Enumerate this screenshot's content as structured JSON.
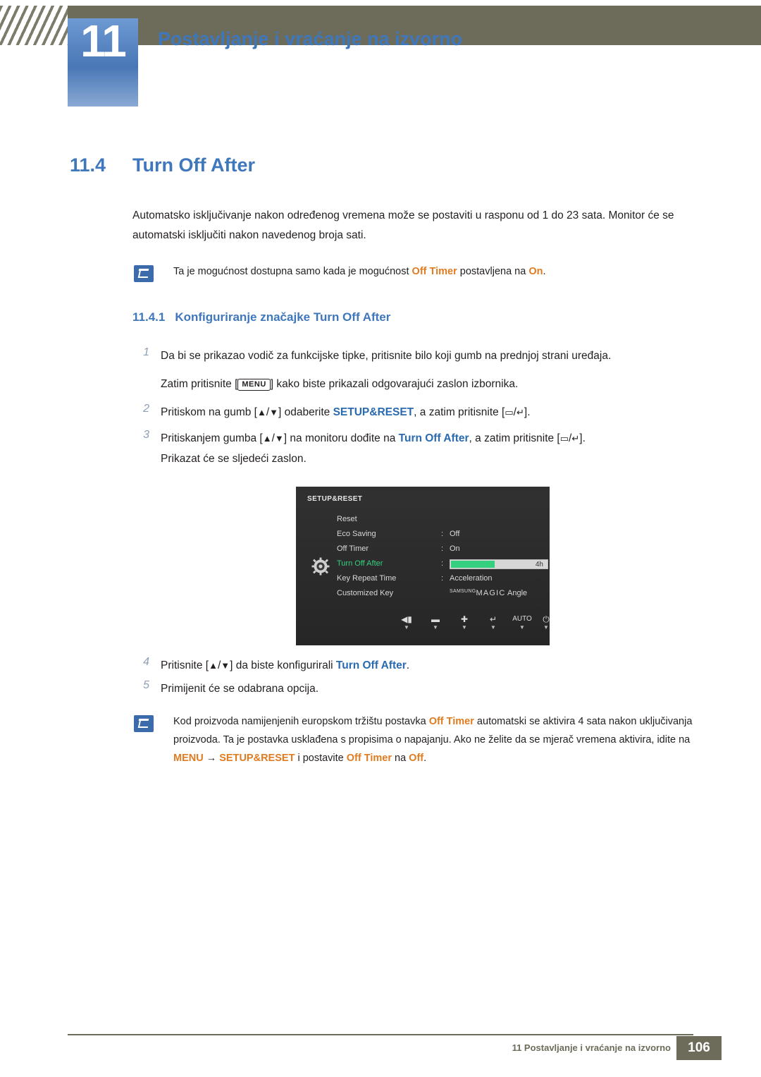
{
  "header": {
    "chapter_number": "11",
    "title": "Postavljanje i vraćanje na izvorno"
  },
  "section": {
    "number": "11.4",
    "title": "Turn Off After"
  },
  "intro": "Automatsko isključivanje nakon određenog vremena može se postaviti u rasponu od 1 do 23 sata. Monitor će se automatski isključiti nakon navedenog broja sati.",
  "note1": {
    "text_before": "Ta je mogućnost dostupna samo kada je mogućnost ",
    "highlight1": "Off Timer",
    "text_mid": " postavljena na ",
    "highlight2": "On",
    "text_after": "."
  },
  "subsection": {
    "number": "11.4.1",
    "title": "Konfiguriranje značajke Turn Off After"
  },
  "steps": {
    "n1": "1",
    "n2": "2",
    "n3": "3",
    "n4": "4",
    "n5": "5",
    "s1a": "Da bi se prikazao vodič za funkcijske tipke, pritisnite bilo koji gumb na prednjoj strani uređaja.",
    "s1b_before": "Zatim pritisnite [",
    "s1b_key": "MENU",
    "s1b_after": "] kako biste prikazali odgovarajući zaslon izbornika.",
    "s2_before": "Pritiskom na gumb [",
    "s2_up": "▲",
    "s2_slash": "/",
    "s2_down": "▼",
    "s2_mid": "] odaberite ",
    "s2_menu": "SETUP&RESET",
    "s2_mid2": ", a zatim pritisnite [",
    "s2_icon1": "▭",
    "s2_icon2": "↵",
    "s2_after": "].",
    "s3_before": "Pritiskanjem gumba [",
    "s3_mid": "] na monitoru dođite na ",
    "s3_item": "Turn Off After",
    "s3_mid2": ", a zatim pritisnite [",
    "s3_after": "].",
    "s3b": "Prikazat će se sljedeći zaslon.",
    "s4_before": "Pritisnite [",
    "s4_mid": "] da biste konfigurirali ",
    "s4_item": "Turn Off After",
    "s4_after": ".",
    "s5": "Primijenit će se odabrana opcija."
  },
  "osd": {
    "title": "SETUP&RESET",
    "rows": [
      {
        "label": "Reset",
        "colon": "",
        "value": ""
      },
      {
        "label": "Eco Saving",
        "colon": ":",
        "value": "Off"
      },
      {
        "label": "Off Timer",
        "colon": ":",
        "value": "On"
      },
      {
        "label": "Turn Off After",
        "colon": ":",
        "value": "4h"
      },
      {
        "label": "Key Repeat Time",
        "colon": ":",
        "value": "Acceleration"
      },
      {
        "label": "Customized Key",
        "colon": "",
        "value": "Angle"
      }
    ],
    "magic_brand": "SAMSUNG",
    "magic_word": "MAGIC",
    "slider_value": "4h",
    "slider_percent": 45,
    "buttons": [
      {
        "icon": "◀▮",
        "arrow": "▼"
      },
      {
        "icon": "▬",
        "arrow": "▼"
      },
      {
        "icon": "✚",
        "arrow": "▼"
      },
      {
        "icon": "↵",
        "arrow": "▼"
      },
      {
        "icon": "AUTO",
        "arrow": "▼"
      },
      {
        "icon": "⏻",
        "arrow": "▼"
      }
    ]
  },
  "note2": {
    "t1": "Kod proizvoda namijenjenih europskom tržištu postavka ",
    "h1": "Off Timer",
    "t2": " automatski se aktivira 4 sata nakon uključivanja proizvoda. Ta je postavka usklađena s propisima o napajanju. Ako ne želite da se mjerač vremena aktivira, idite na ",
    "h2": "MENU",
    "t3": "  →  ",
    "h3": "SETUP&RESET",
    "t4": " i postavite ",
    "h4": "Off Timer",
    "t5": " na ",
    "h5": "Off",
    "t6": "."
  },
  "footer": {
    "text": "11 Postavljanje i vraćanje na izvorno",
    "page": "106"
  }
}
